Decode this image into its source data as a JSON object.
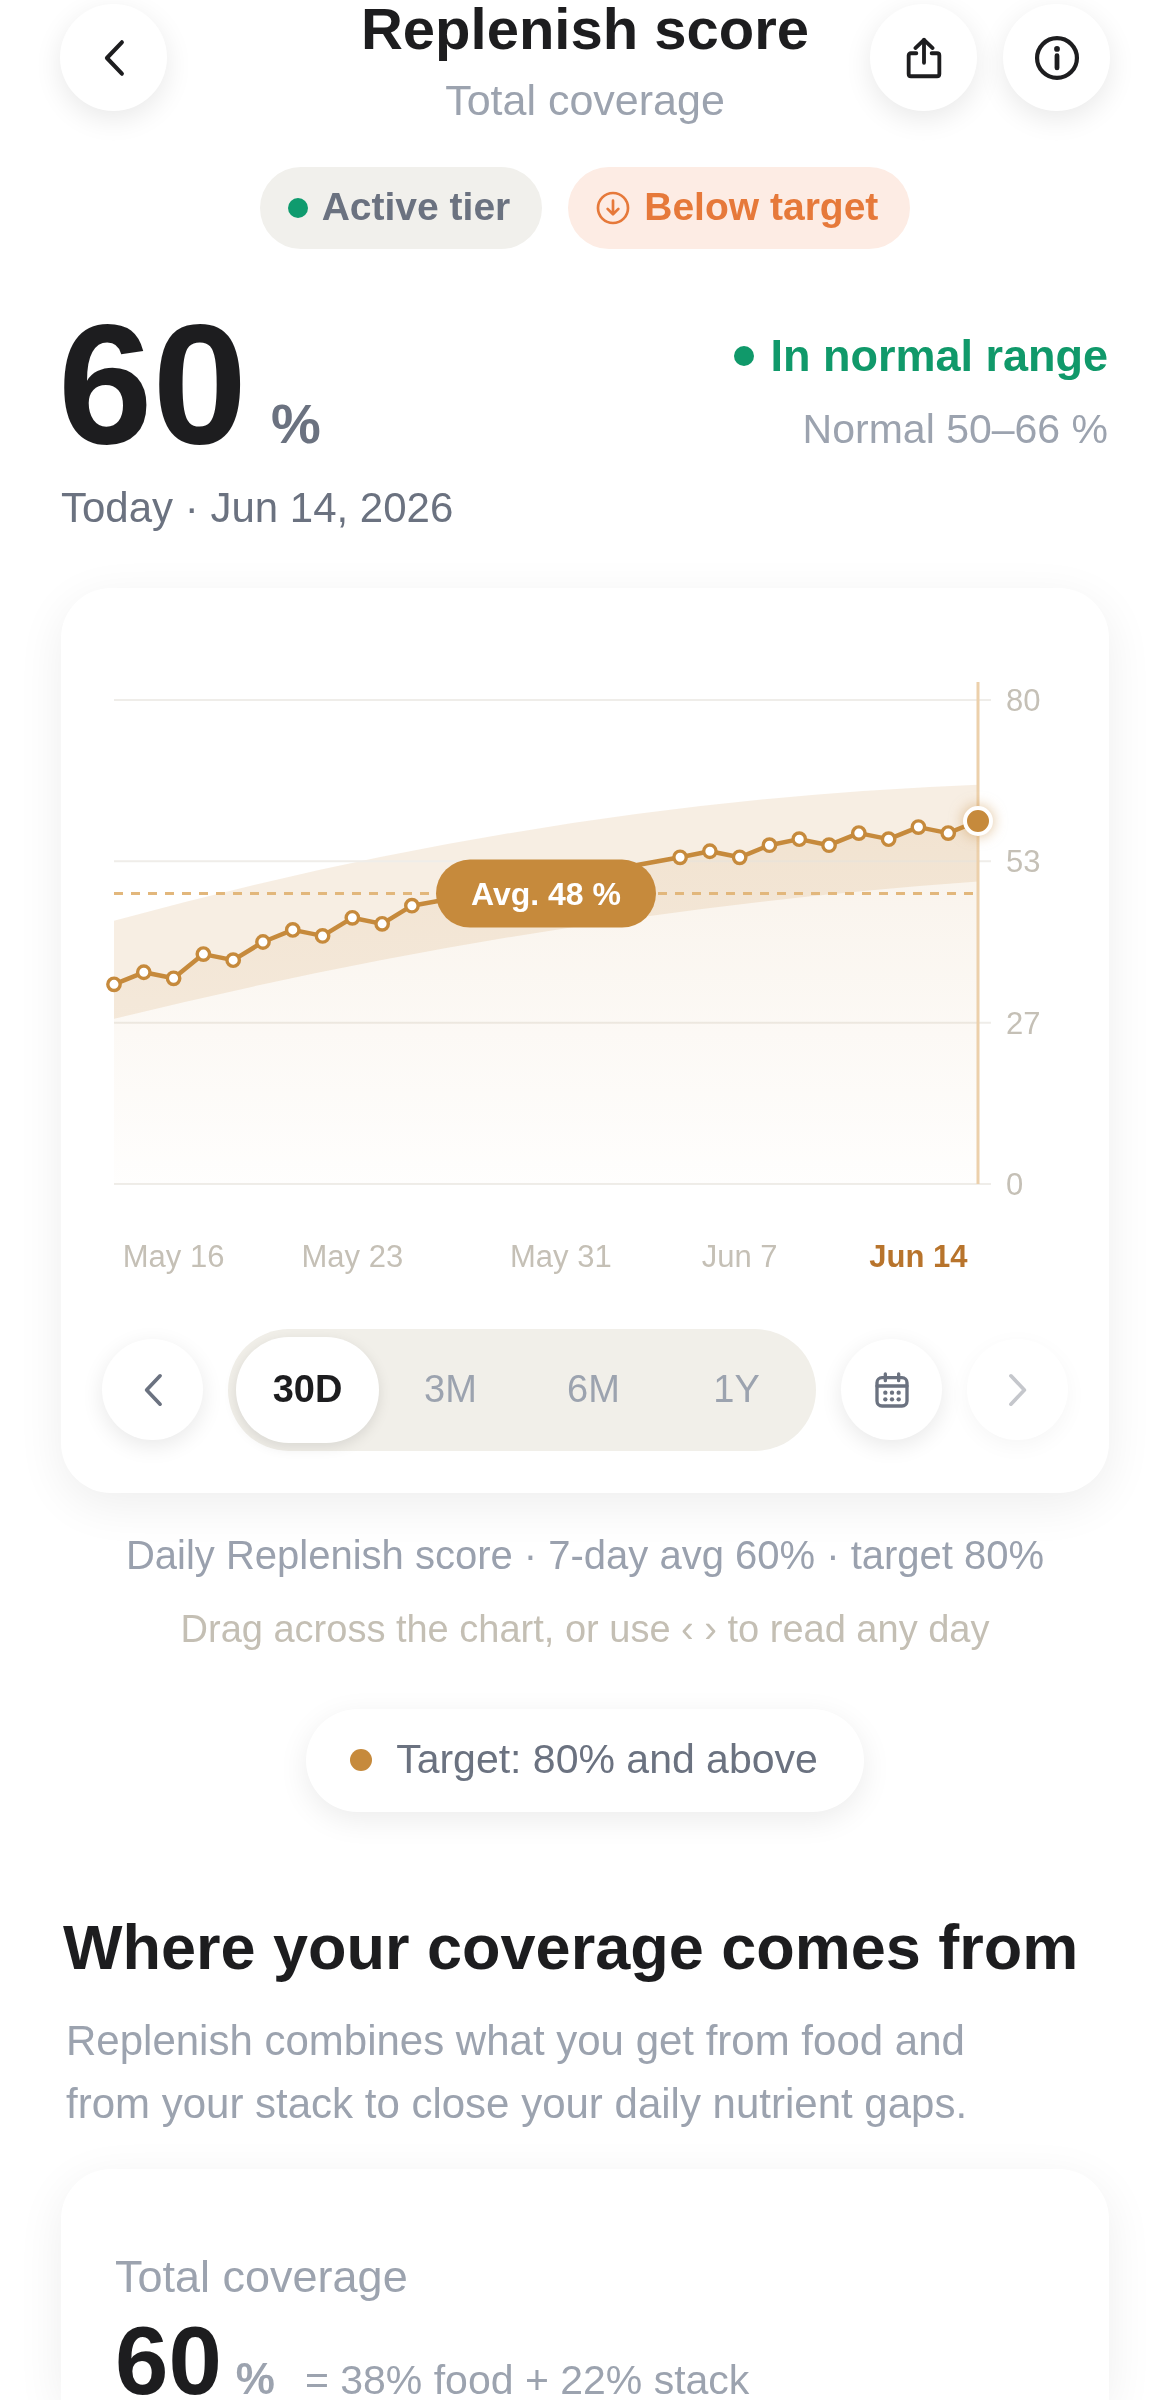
{
  "header": {
    "title": "Replenish score",
    "subtitle": "Total coverage"
  },
  "chips": [
    {
      "kind": "tier",
      "label": "Active tier"
    },
    {
      "kind": "alert",
      "label": "Below target"
    }
  ],
  "score": {
    "value": "60",
    "unit": "%",
    "date": "Today · Jun 14, 2026",
    "status": {
      "kind": "normal",
      "label": "In normal range"
    },
    "range": "Normal 50–66 %"
  },
  "chart": {
    "chart_data": {
      "type": "area",
      "marker": "o",
      "categories": [
        null,
        null,
        "May 16",
        null,
        null,
        null,
        null,
        null,
        "May 23",
        null,
        null,
        null,
        null,
        null,
        null,
        "May 31",
        null,
        null,
        null,
        null,
        null,
        "Jun 7",
        null,
        null,
        null,
        null,
        null,
        "Jun 14",
        null,
        null
      ],
      "values": [
        33,
        35,
        34,
        38,
        37,
        40,
        42,
        41,
        44,
        43,
        46,
        null,
        null,
        null,
        null,
        null,
        null,
        null,
        null,
        54,
        55,
        54,
        56,
        57,
        56,
        58,
        57,
        59,
        58,
        60
      ],
      "ylim": [
        0,
        80
      ],
      "yticks": [
        0,
        {
          "value": 26.67,
          "label": "27"
        },
        {
          "value": 53.33,
          "label": "53"
        },
        80
      ],
      "ref_lines": [
        {
          "axis": "y",
          "value": 48,
          "label": "Avg. 48 %"
        }
      ]
    },
    "highlight_latest": true,
    "prev": {
      "disabled": false
    },
    "periods": [
      {
        "label": "30D",
        "selected": true
      },
      {
        "label": "3M",
        "selected": false
      },
      {
        "label": "6M",
        "selected": false
      },
      {
        "label": "1Y",
        "selected": false
      }
    ],
    "next": {
      "disabled": true
    }
  },
  "caption": "Daily Replenish score · 7-day avg 60% · target 80%",
  "hint": "Drag across the chart, or use ‹ › to read any day",
  "target": {
    "label": "Target: 80% and above"
  },
  "section": {
    "title": "Where your coverage comes from",
    "text": "Replenish combines what you get from food and from your stack to close your daily nutrient gaps."
  },
  "coverage_card": {
    "label": "Total coverage",
    "value": "60",
    "unit": "%",
    "breakdown": "= 38% food + 22% stack"
  }
}
